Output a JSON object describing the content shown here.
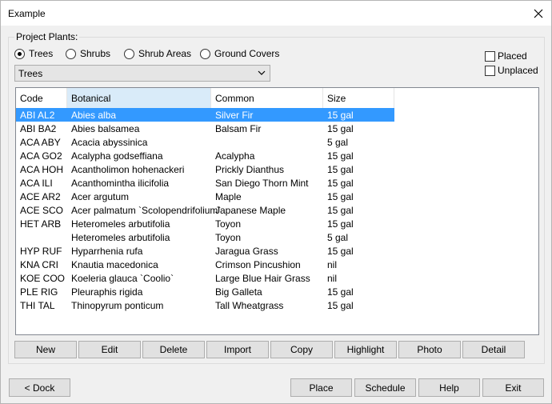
{
  "window": {
    "title": "Example"
  },
  "project_plants": {
    "label": "Project Plants:",
    "radios": [
      {
        "label": "Trees",
        "checked": true
      },
      {
        "label": "Shrubs",
        "checked": false
      },
      {
        "label": "Shrub Areas",
        "checked": false
      },
      {
        "label": "Ground Covers",
        "checked": false
      }
    ],
    "filters": [
      {
        "label": "Placed",
        "checked": false
      },
      {
        "label": "Unplaced",
        "checked": false
      }
    ],
    "combo_value": "Trees"
  },
  "table": {
    "columns": [
      "Code",
      "Botanical",
      "Common",
      "Size"
    ],
    "rows": [
      [
        "ABI AL2",
        "Abies alba",
        "Silver Fir",
        "15 gal"
      ],
      [
        "ABI BA2",
        "Abies balsamea",
        "Balsam Fir",
        "15 gal"
      ],
      [
        "ACA ABY",
        "Acacia abyssinica",
        "",
        "5 gal"
      ],
      [
        "ACA GO2",
        "Acalypha godseffiana",
        "Acalypha",
        "15 gal"
      ],
      [
        "ACA HOH",
        "Acantholimon hohenackeri",
        "Prickly Dianthus",
        "15 gal"
      ],
      [
        "ACA ILI",
        "Acanthomintha ilicifolia",
        "San Diego Thorn Mint",
        "15 gal"
      ],
      [
        "ACE AR2",
        "Acer argutum",
        "Maple",
        "15 gal"
      ],
      [
        "ACE SCO",
        "Acer palmatum `Scolopendrifolium`",
        "Japanese Maple",
        "15 gal"
      ],
      [
        "HET ARB",
        "Heteromeles arbutifolia",
        "Toyon",
        "15 gal"
      ],
      [
        "",
        "Heteromeles arbutifolia",
        "Toyon",
        "5 gal"
      ],
      [
        "HYP RUF",
        "Hyparrhenia rufa",
        "Jaragua Grass",
        "15 gal"
      ],
      [
        "KNA CRI",
        "Knautia macedonica",
        "Crimson Pincushion",
        "nil"
      ],
      [
        "KOE COO",
        "Koeleria glauca `Coolio`",
        "Large Blue Hair Grass",
        "nil"
      ],
      [
        "PLE RIG",
        "Pleuraphis rigida",
        "Big Galleta",
        "15 gal"
      ],
      [
        "THI TAL",
        "Thinopyrum  ponticum",
        "Tall Wheatgrass",
        "15 gal"
      ]
    ],
    "selected_row": 0
  },
  "list_buttons": {
    "new": "New",
    "edit": "Edit",
    "delete": "Delete",
    "import": "Import",
    "copy": "Copy",
    "highlight": "Highlight",
    "photo": "Photo",
    "detail": "Detail"
  },
  "bottom_buttons": {
    "dock": "< Dock",
    "place": "Place",
    "schedule": "Schedule",
    "help": "Help",
    "exit": "Exit"
  },
  "colors": {
    "selection": "#3399ff",
    "sorted_header": "#d9ebf9"
  }
}
